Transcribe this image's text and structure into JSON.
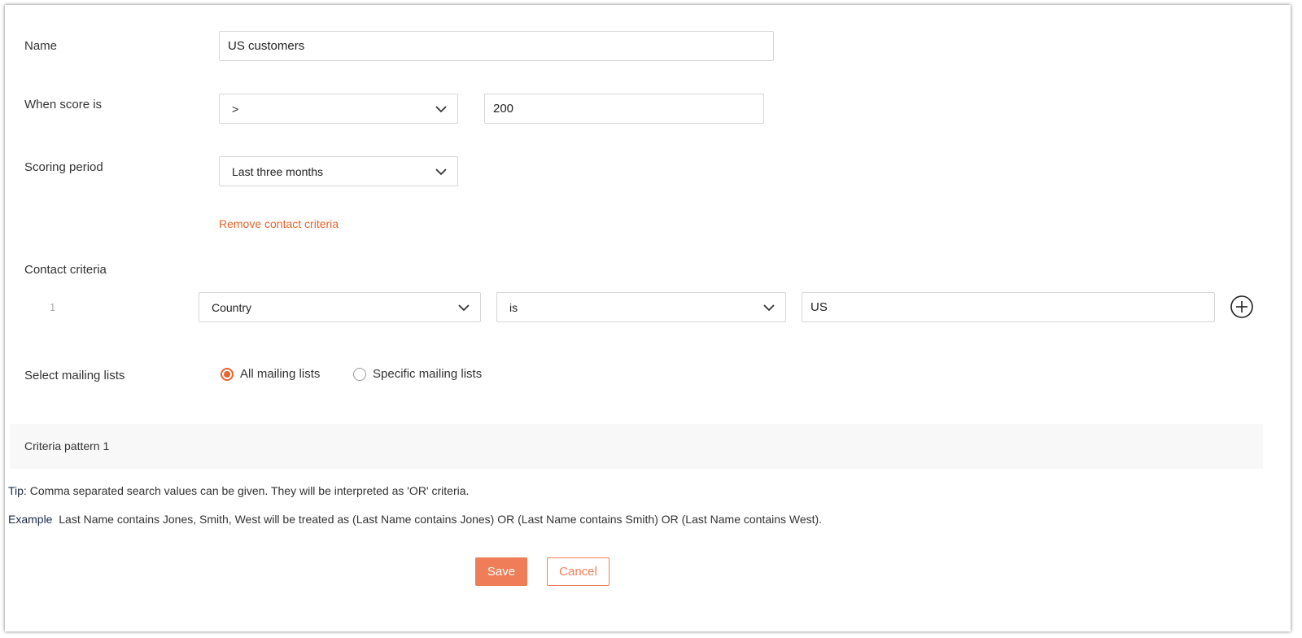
{
  "form": {
    "name_label": "Name",
    "name_value": "US customers",
    "score_label": "When score is",
    "score_operator": ">",
    "score_value": "200",
    "period_label": "Scoring period",
    "period_value": "Last three months",
    "remove_criteria_link": "Remove contact criteria",
    "criteria_label": "Contact criteria",
    "criteria_rows": [
      {
        "number": "1",
        "field": "Country",
        "operator": "is",
        "value": "US"
      }
    ],
    "mailing_label": "Select mailing lists",
    "mailing_options": [
      {
        "label": "All mailing lists",
        "selected": true
      },
      {
        "label": "Specific mailing lists",
        "selected": false
      }
    ],
    "pattern_label": "Criteria pattern 1"
  },
  "tips": {
    "tip_prefix": "Tip:",
    "tip_text": " Comma separated search values can be given. They will be interpreted as 'OR' criteria.",
    "example_prefix": "Example",
    "example_text": "  Last Name contains Jones, Smith, West will be treated as (Last Name contains Jones) OR (Last Name contains Smith) OR (Last Name contains West)."
  },
  "actions": {
    "save_label": "Save",
    "cancel_label": "Cancel"
  },
  "colors": {
    "accent": "#e8642d",
    "button": "#ee7d58"
  },
  "icons": {
    "dropdown": "chevron-down-icon",
    "add": "plus-circle-icon"
  }
}
